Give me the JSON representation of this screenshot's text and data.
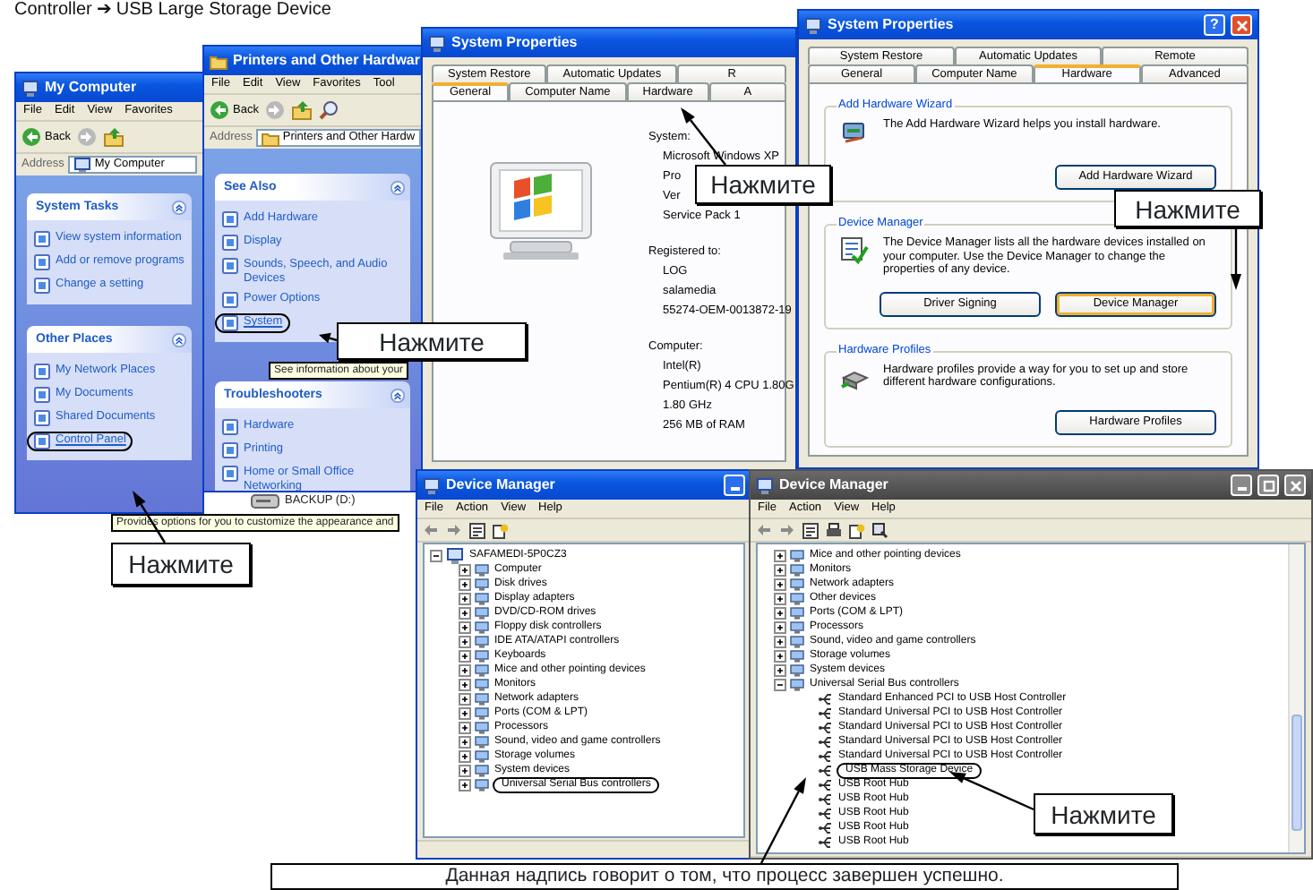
{
  "caption": "Controller ➔ USB Large Storage Device",
  "windows": [
    {
      "kind": "explorer",
      "active": true,
      "title": "My Computer",
      "menu": [
        "File",
        "Edit",
        "View",
        "Favorites"
      ],
      "back": "Back",
      "address_label": "Address",
      "address": "My Computer",
      "panels": [
        {
          "title": "System Tasks",
          "items": [
            {
              "label": "View system information",
              "circled": false
            },
            {
              "label": "Add or remove programs",
              "circled": false
            },
            {
              "label": "Change a setting",
              "circled": false
            }
          ]
        },
        {
          "title": "Other Places",
          "items": [
            {
              "label": "My Network Places",
              "circled": false
            },
            {
              "label": "My Documents",
              "circled": false
            },
            {
              "label": "Shared Documents",
              "circled": false
            },
            {
              "label": "Control Panel",
              "circled": true
            }
          ]
        }
      ]
    },
    {
      "kind": "explorer",
      "active": true,
      "title": "Printers and Other Hardwar",
      "menu": [
        "File",
        "Edit",
        "View",
        "Favorites",
        "Tool"
      ],
      "back": "Back",
      "address_label": "Address",
      "address": "Printers and Other Hardw",
      "panels": [
        {
          "title": "See Also",
          "items": [
            {
              "label": "Add Hardware",
              "circled": false
            },
            {
              "label": "Display",
              "circled": false
            },
            {
              "label": "Sounds, Speech, and Audio Devices",
              "circled": false
            },
            {
              "label": "Power Options",
              "circled": false
            },
            {
              "label": "System",
              "circled": true
            }
          ]
        },
        {
          "title": "Troubleshooters",
          "items": [
            {
              "label": "Hardware",
              "circled": false
            },
            {
              "label": "Printing",
              "circled": false
            },
            {
              "label": "Home or Small Office Networking",
              "circled": false
            }
          ]
        }
      ]
    },
    {
      "kind": "properties",
      "active": true,
      "title": "System Properties",
      "tab_rows": [
        [
          {
            "label": "System Restore",
            "selected": false
          },
          {
            "label": "Automatic Updates",
            "selected": false
          },
          {
            "label": "R",
            "selected": false
          }
        ],
        [
          {
            "label": "General",
            "selected": true
          },
          {
            "label": "Computer Name",
            "selected": false
          },
          {
            "label": "Hardware",
            "selected": false
          },
          {
            "label": "A",
            "selected": false
          }
        ]
      ],
      "page": {
        "kind": "general",
        "sections": [
          {
            "heading": "System:",
            "lines": [
              "Microsoft Windows XP",
              "Pro",
              "Ver",
              "Service Pack 1"
            ]
          },
          {
            "heading": "Registered to:",
            "lines": [
              "LOG",
              "salamedia",
              "55274-OEM-0013872-19"
            ]
          },
          {
            "heading": "Computer:",
            "lines": [
              "Intel(R)",
              "Pentium(R) 4 CPU 1.80G",
              "1.80 GHz",
              "256 MB of RAM"
            ]
          }
        ]
      }
    },
    {
      "kind": "properties",
      "active": true,
      "title": "System Properties",
      "title_buttons": [
        {
          "kind": "help",
          "glyph": "?"
        },
        {
          "kind": "close"
        }
      ],
      "tab_rows": [
        [
          {
            "label": "System Restore",
            "selected": false
          },
          {
            "label": "Automatic Updates",
            "selected": false
          },
          {
            "label": "Remote",
            "selected": false
          }
        ],
        [
          {
            "label": "General",
            "selected": false
          },
          {
            "label": "Computer Name",
            "selected": false
          },
          {
            "label": "Hardware",
            "selected": true
          },
          {
            "label": "Advanced",
            "selected": false
          }
        ]
      ],
      "page": {
        "kind": "hardware",
        "groups": [
          {
            "title": "Add Hardware Wizard",
            "text": "The Add Hardware Wizard helps you install hardware.",
            "buttons": [
              {
                "label": "Add Hardware Wizard",
                "highlighted": false
              }
            ]
          },
          {
            "title": "Device Manager",
            "text": "The Device Manager lists all the hardware devices installed on your computer. Use the Device Manager to change the properties of any device.",
            "buttons": [
              {
                "label": "Driver Signing",
                "highlighted": false
              },
              {
                "label": "Device Manager",
                "highlighted": true
              }
            ]
          },
          {
            "title": "Hardware Profiles",
            "text": "Hardware profiles provide a way for you to set up and store different hardware configurations.",
            "buttons": [
              {
                "label": "Hardware Profiles",
                "highlighted": false
              }
            ]
          }
        ]
      }
    },
    {
      "kind": "device_manager",
      "active": true,
      "title": "Device Manager",
      "title_buttons": [
        {
          "kind": "minimize"
        }
      ],
      "menu": [
        "File",
        "Action",
        "View",
        "Help"
      ],
      "root": {
        "label": "SAFAMEDI-5P0CZ3",
        "expanded": true
      },
      "nodes": [
        {
          "label": "Computer",
          "expanded": false,
          "circled": false
        },
        {
          "label": "Disk drives",
          "expanded": false,
          "circled": false
        },
        {
          "label": "Display adapters",
          "expanded": false,
          "circled": false
        },
        {
          "label": "DVD/CD-ROM drives",
          "expanded": false,
          "circled": false
        },
        {
          "label": "Floppy disk controllers",
          "expanded": false,
          "circled": false
        },
        {
          "label": "IDE ATA/ATAPI controllers",
          "expanded": false,
          "circled": false
        },
        {
          "label": "Keyboards",
          "expanded": false,
          "circled": false
        },
        {
          "label": "Mice and other pointing devices",
          "expanded": false,
          "circled": false
        },
        {
          "label": "Monitors",
          "expanded": false,
          "circled": false
        },
        {
          "label": "Network adapters",
          "expanded": false,
          "circled": false
        },
        {
          "label": "Ports (COM & LPT)",
          "expanded": false,
          "circled": false
        },
        {
          "label": "Processors",
          "expanded": false,
          "circled": false
        },
        {
          "label": "Sound, video and game controllers",
          "expanded": false,
          "circled": false
        },
        {
          "label": "Storage volumes",
          "expanded": false,
          "circled": false
        },
        {
          "label": "System devices",
          "expanded": false,
          "circled": false
        },
        {
          "label": "Universal Serial Bus controllers",
          "expanded": false,
          "circled": true
        }
      ]
    },
    {
      "kind": "device_manager",
      "active": false,
      "title": "Device Manager",
      "title_buttons": [
        {
          "kind": "minimize"
        },
        {
          "kind": "maximize"
        },
        {
          "kind": "close"
        }
      ],
      "menu": [
        "File",
        "Action",
        "View",
        "Help"
      ],
      "nodes": [
        {
          "label": "Mice and other pointing devices",
          "expanded": false,
          "circled": false
        },
        {
          "label": "Monitors",
          "expanded": false,
          "circled": false
        },
        {
          "label": "Network adapters",
          "expanded": false,
          "circled": false
        },
        {
          "label": "Other devices",
          "expanded": false,
          "circled": false
        },
        {
          "label": "Ports (COM & LPT)",
          "expanded": false,
          "circled": false
        },
        {
          "label": "Processors",
          "expanded": false,
          "circled": false
        },
        {
          "label": "Sound, video and game controllers",
          "expanded": false,
          "circled": false
        },
        {
          "label": "Storage volumes",
          "expanded": false,
          "circled": false
        },
        {
          "label": "System devices",
          "expanded": false,
          "circled": false
        },
        {
          "label": "Universal Serial Bus controllers",
          "expanded": true,
          "circled": false,
          "children": [
            {
              "label": "Standard Enhanced PCI to USB Host Controller",
              "circled": false
            },
            {
              "label": "Standard Universal PCI to USB Host Controller",
              "circled": false
            },
            {
              "label": "Standard Universal PCI to USB Host Controller",
              "circled": false
            },
            {
              "label": "Standard Universal PCI to USB Host Controller",
              "circled": false
            },
            {
              "label": "Standard Universal PCI to USB Host Controller",
              "circled": false
            },
            {
              "label": "USB Mass Storage Device",
              "circled": true
            },
            {
              "label": "USB Root Hub",
              "circled": false
            },
            {
              "label": "USB Root Hub",
              "circled": false
            },
            {
              "label": "USB Root Hub",
              "circled": false
            },
            {
              "label": "USB Root Hub",
              "circled": false
            },
            {
              "label": "USB Root Hub",
              "circled": false
            }
          ]
        }
      ]
    }
  ],
  "background_items": [
    {
      "label": "BACKUP (D:)"
    }
  ],
  "tooltips": [
    {
      "text": "See information about your"
    },
    {
      "text": "Provides options for you to customize the appearance and"
    }
  ],
  "callouts": [
    {
      "text": "Нажмите"
    },
    {
      "text": "Нажмите"
    },
    {
      "text": "Нажмите"
    },
    {
      "text": "Нажмите"
    },
    {
      "text": "Нажмите"
    }
  ],
  "note": "Данная надпись говорит о том, что процесс завершен успешно."
}
